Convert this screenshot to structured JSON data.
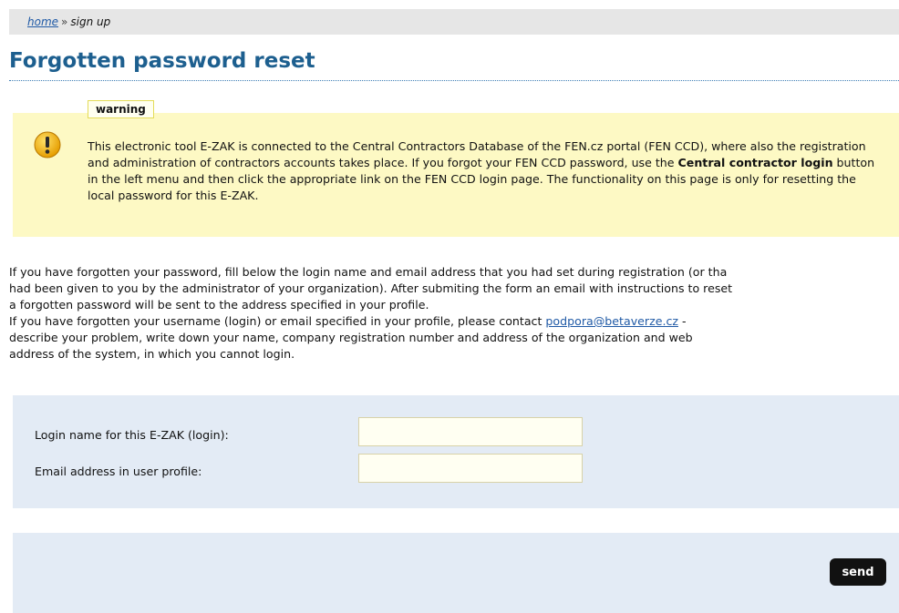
{
  "breadcrumb": {
    "home": "home",
    "separator": "»",
    "current": "sign up"
  },
  "page": {
    "title": "Forgotten password reset"
  },
  "warning": {
    "tag": "warning",
    "icon": "exclamation-icon",
    "text_before": "This electronic tool E-ZAK is connected to the Central Contractors Database of the FEN.cz portal (FEN CCD), where also the registration and administration of contractors accounts takes place. If you forgot your FEN CCD password, use the ",
    "text_bold": "Central contractor login",
    "text_after": " button in the left menu and then click the appropriate link on the FEN CCD login page. The functionality on this page is only for resetting the local password for this E-ZAK."
  },
  "intro": {
    "line1": "If you have forgotten your password, fill below the login name and email address that you had set during registration (or tha",
    "line2": "had been given to you by the administrator of your organization). After submiting the form an email with instructions to reset",
    "line3": "a forgotten password will be sent to the address specified in your profile.",
    "line4_before": "If you have forgotten your username (login) or email specified in your profile, please contact ",
    "contact_email": "podpora@betaverze.cz",
    "line4_after": " -",
    "line5": "describe your problem, write down your name, company registration number and address of the organization and web",
    "line6": "address of the system, in which you cannot login."
  },
  "form": {
    "login_label": "Login name for this E-ZAK (login):",
    "login_value": "",
    "email_label": "Email address in user profile:",
    "email_value": ""
  },
  "actions": {
    "send_label": "send"
  },
  "colors": {
    "title": "#1d5f8f",
    "link": "#205aa6",
    "warning_bg": "#fdf9c4",
    "form_bg": "#e3ebf5",
    "icon": "#f0b400"
  }
}
